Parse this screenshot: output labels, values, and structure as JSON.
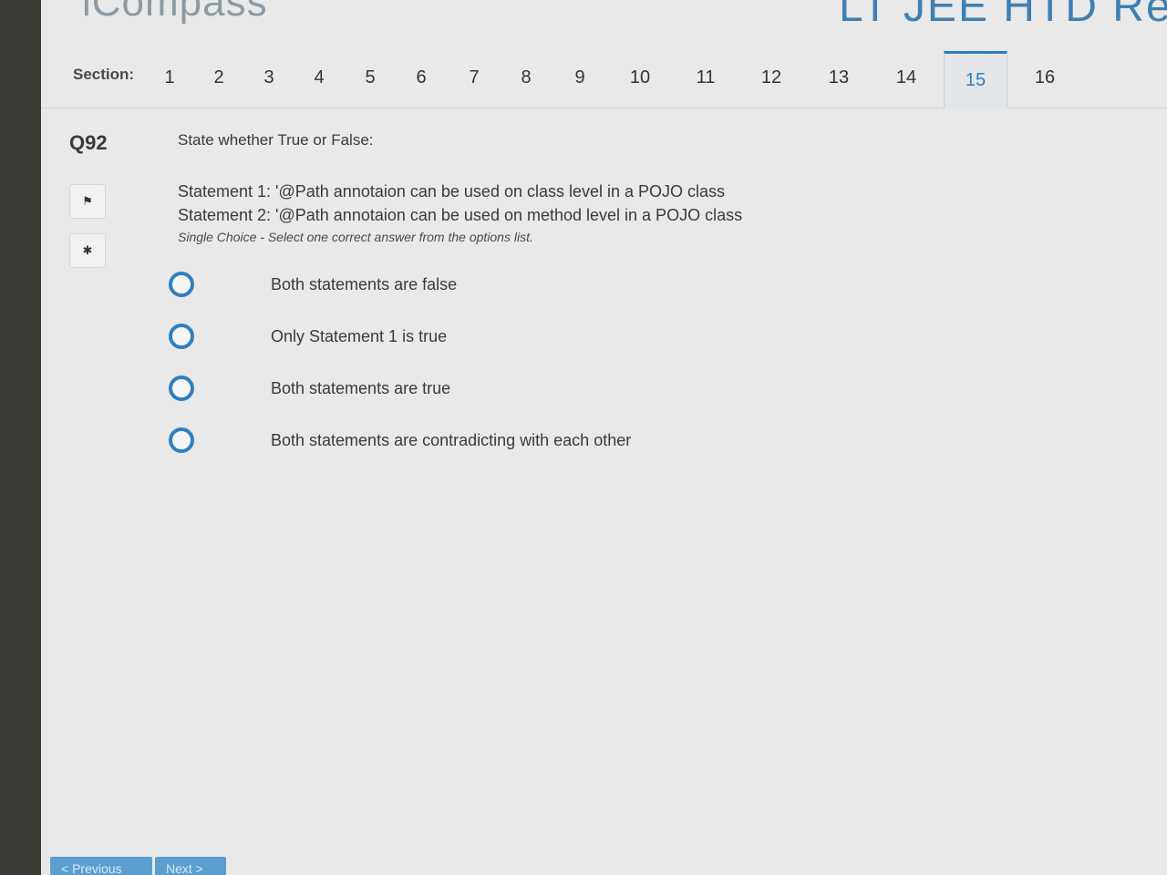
{
  "header": {
    "logo_text": "iCompass",
    "exam_title": "LT JEE HTD Refes"
  },
  "sections": {
    "label": "Section:",
    "tabs": [
      "1",
      "2",
      "3",
      "4",
      "5",
      "6",
      "7",
      "8",
      "9",
      "10",
      "11",
      "12",
      "13",
      "14",
      "15",
      "16"
    ],
    "active": "15"
  },
  "question": {
    "number": "Q92",
    "instruction": "State whether True or False:",
    "statement1": "Statement 1: '@Path annotaion can be used on class level in a POJO class",
    "statement2": "Statement 2: '@Path annotaion can be used on method level in a POJO class",
    "hint": "Single Choice - Select one correct answer from the options list.",
    "options": [
      "Both statements are false",
      "Only Statement 1 is true",
      "Both statements are true",
      "Both statements are contradicting with each other"
    ]
  },
  "side_icons": [
    "flag-icon",
    "bug-icon"
  ],
  "icon_glyphs": {
    "flag": "⚑",
    "bug": "✱"
  },
  "footer": {
    "previous_label": "< Previous",
    "next_label": "Next >"
  },
  "colors": {
    "accent": "#2f7fc0",
    "background": "#e9e9e9",
    "bezel": "#3a3d36"
  }
}
